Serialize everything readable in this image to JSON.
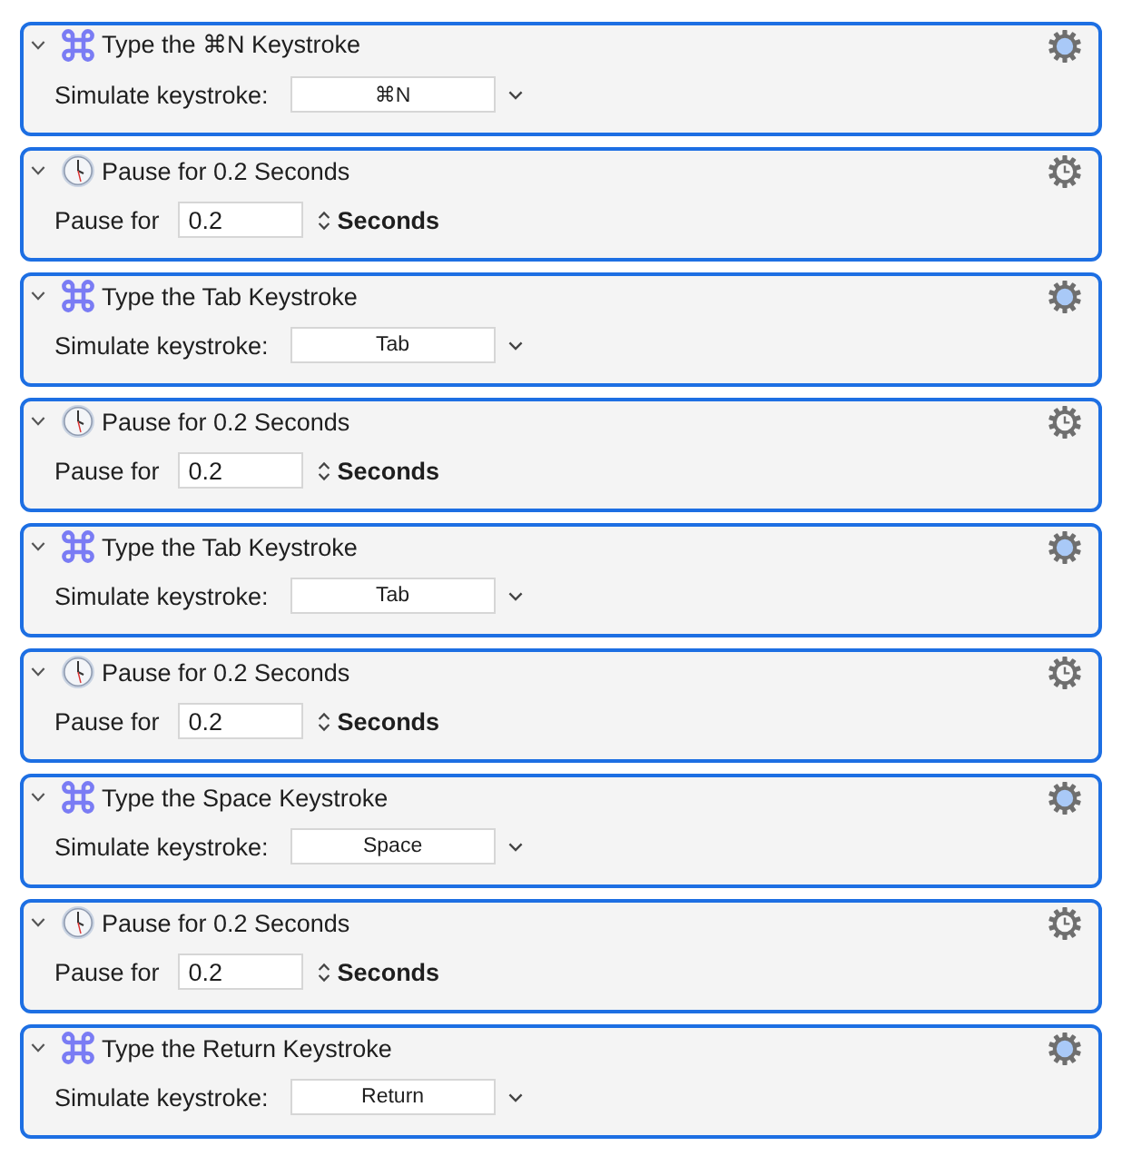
{
  "actions": [
    {
      "kind": "keystroke",
      "expanded": true,
      "title": "Type the ⌘N Keystroke",
      "label": "Simulate keystroke:",
      "value": "⌘N"
    },
    {
      "kind": "pause",
      "expanded": true,
      "title": "Pause for 0.2 Seconds",
      "label": "Pause for",
      "value": "0.2",
      "unit": "Seconds"
    },
    {
      "kind": "keystroke",
      "expanded": true,
      "title": "Type the Tab Keystroke",
      "label": "Simulate keystroke:",
      "value": "Tab"
    },
    {
      "kind": "pause",
      "expanded": true,
      "title": "Pause for 0.2 Seconds",
      "label": "Pause for",
      "value": "0.2",
      "unit": "Seconds"
    },
    {
      "kind": "keystroke",
      "expanded": true,
      "title": "Type the Tab Keystroke",
      "label": "Simulate keystroke:",
      "value": "Tab"
    },
    {
      "kind": "pause",
      "expanded": true,
      "title": "Pause for 0.2 Seconds",
      "label": "Pause for",
      "value": "0.2",
      "unit": "Seconds"
    },
    {
      "kind": "keystroke",
      "expanded": true,
      "title": "Type the Space Keystroke",
      "label": "Simulate keystroke:",
      "value": "Space"
    },
    {
      "kind": "pause",
      "expanded": true,
      "title": "Pause for 0.2 Seconds",
      "label": "Pause for",
      "value": "0.2",
      "unit": "Seconds"
    },
    {
      "kind": "keystroke",
      "expanded": true,
      "title": "Type the Return Keystroke",
      "label": "Simulate keystroke:",
      "value": "Return"
    }
  ]
}
